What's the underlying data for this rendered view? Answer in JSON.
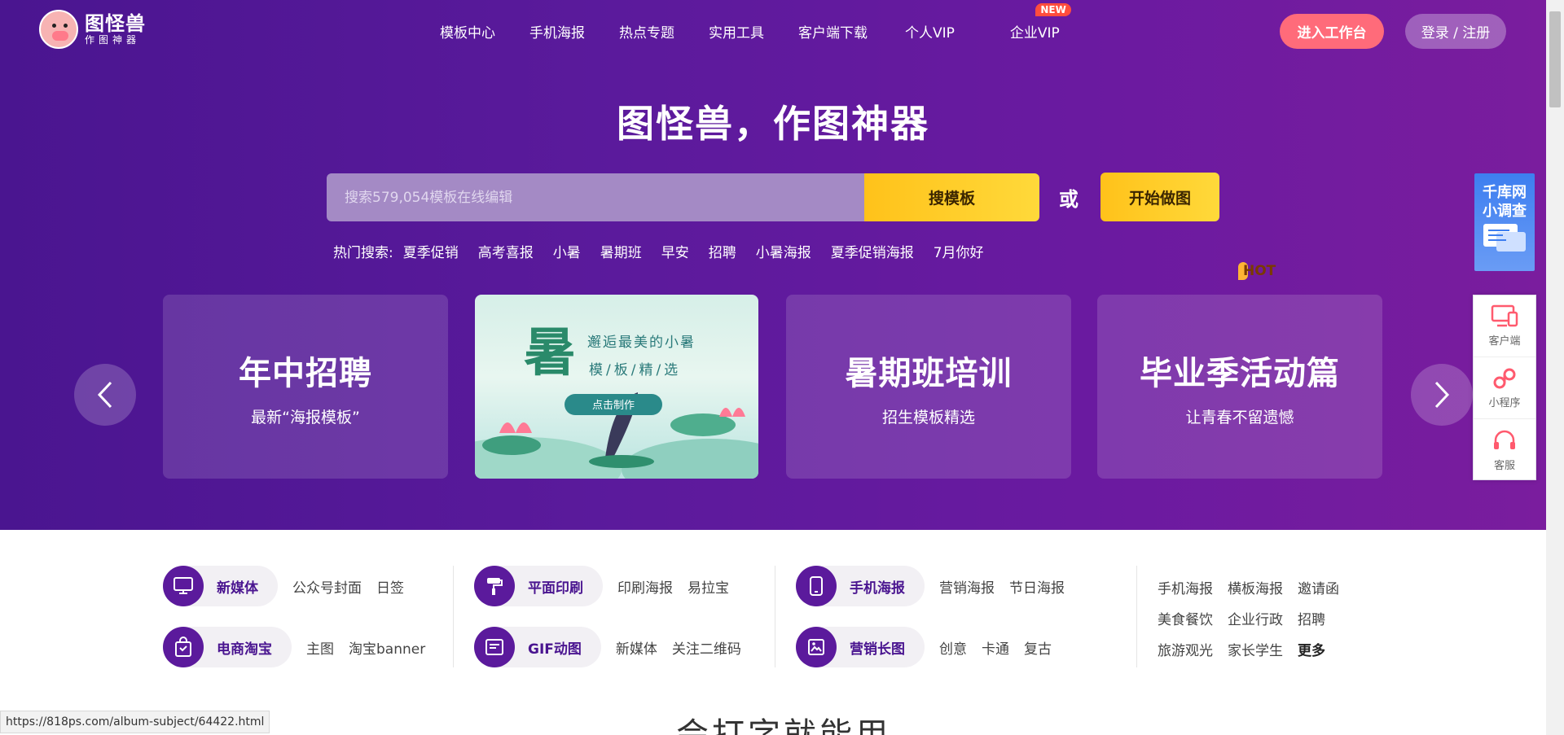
{
  "logo": {
    "name": "图怪兽",
    "slogan": "作图神器"
  },
  "nav": [
    {
      "label": "模板中心"
    },
    {
      "label": "手机海报"
    },
    {
      "label": "热点专题"
    },
    {
      "label": "实用工具"
    },
    {
      "label": "客户端下载"
    },
    {
      "label": "个人VIP",
      "badge": "HOT"
    },
    {
      "label": "企业VIP",
      "badge": "NEW"
    }
  ],
  "header": {
    "workbench": "进入工作台",
    "login": "登录 / 注册"
  },
  "hero": {
    "title": "图怪兽，作图神器"
  },
  "search": {
    "placeholder": "搜索579,054模板在线编辑",
    "button": "搜模板",
    "or": "或",
    "start": "开始做图"
  },
  "hot": {
    "label": "热门搜索:",
    "tags": [
      "夏季促销",
      "高考喜报",
      "小暑",
      "暑期班",
      "早安",
      "招聘",
      "小暑海报",
      "夏季促销海报",
      "7月你好"
    ]
  },
  "banners": [
    {
      "title": "年中招聘",
      "subtitle": "最新“海报模板”"
    },
    {
      "image_big": "暑",
      "image_title": "邂逅最美的小暑",
      "image_sub": "模/板/精/选",
      "image_btn": "点击制作"
    },
    {
      "title": "暑期班培训",
      "subtitle": "招生模板精选"
    },
    {
      "title": "毕业季活动篇",
      "subtitle": "让青春不留遗憾"
    }
  ],
  "side": {
    "survey": "千库网小调查",
    "items": [
      "客户端",
      "小程序",
      "客服"
    ]
  },
  "categories": [
    {
      "name": "新媒体",
      "icon": "monitor-icon",
      "links": [
        "公众号封面",
        "日签"
      ]
    },
    {
      "name": "电商淘宝",
      "icon": "shopping-bag-icon",
      "links": [
        "主图",
        "淘宝banner"
      ]
    },
    {
      "name": "平面印刷",
      "icon": "paint-roller-icon",
      "links": [
        "印刷海报",
        "易拉宝"
      ]
    },
    {
      "name": "GIF动图",
      "icon": "gif-icon",
      "links": [
        "新媒体",
        "关注二维码"
      ]
    },
    {
      "name": "手机海报",
      "icon": "phone-icon",
      "links": [
        "营销海报",
        "节日海报"
      ]
    },
    {
      "name": "营销长图",
      "icon": "image-icon",
      "links": [
        "创意",
        "卡通",
        "复古"
      ]
    }
  ],
  "tag_rows": [
    [
      "手机海报",
      "横板海报",
      "邀请函"
    ],
    [
      "美食餐饮",
      "企业行政",
      "招聘"
    ],
    [
      "旅游观光",
      "家长学生",
      "更多"
    ]
  ],
  "status_url": "https://818ps.com/album-subject/64422.html",
  "bottom_title": "会打字就能用",
  "colors": {
    "hero_start": "#4a1590",
    "hero_end": "#7a1d9e",
    "accent_yellow": "#ffc21a",
    "accent_pink": "#ff6b7a",
    "survey_blue": "#3d7ef0"
  }
}
